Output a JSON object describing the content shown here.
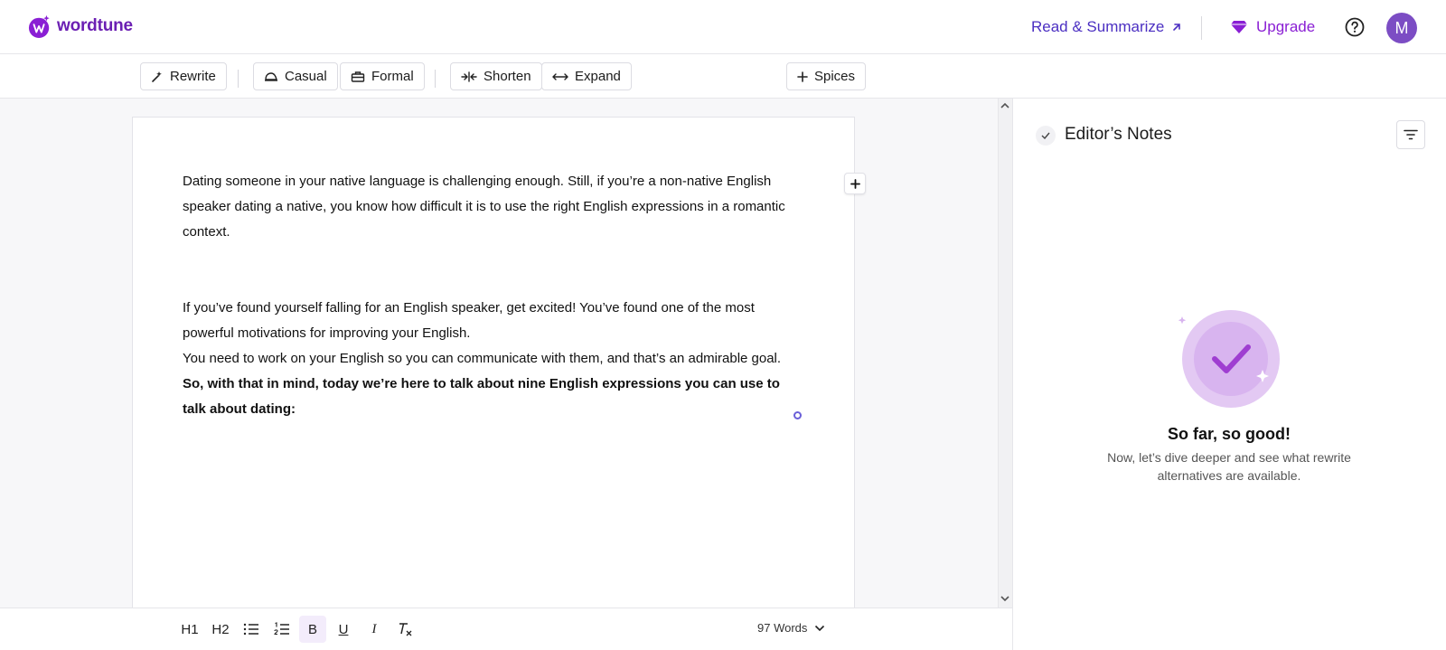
{
  "header": {
    "brand": "wordtune",
    "read_summarize": "Read & Summarize",
    "upgrade": "Upgrade",
    "avatar_initial": "M",
    "accent": "#8a1fd4"
  },
  "toolbar": {
    "rewrite": "Rewrite",
    "casual": "Casual",
    "formal": "Formal",
    "shorten": "Shorten",
    "expand": "Expand",
    "spices": "Spices"
  },
  "document": {
    "paragraphs": [
      "Dating someone in your native language is challenging enough. Still, if you’re a non-native English speaker dating a native, you know how difficult it is to use the right English expressions in a romantic context.",
      "If you’ve found yourself falling for an English speaker, get excited! You’ve found one of the most powerful motivations for improving your English.",
      "You need to work on your English so you can communicate with them, and that’s an admirable goal.",
      "So, with that in mind, today we’re here to talk about nine English expressions you can use to talk about dating:"
    ]
  },
  "format_bar": {
    "h1": "H1",
    "h2": "H2",
    "bold": "B",
    "underline": "U",
    "italic": "I",
    "word_count": "97 Words"
  },
  "notes_panel": {
    "title": "Editor’s Notes",
    "empty_title": "So far, so good!",
    "empty_subtitle": "Now, let’s dive deeper and see what rewrite alternatives are available."
  },
  "icons": [
    "logo-icon",
    "external-link-icon",
    "diamond-icon",
    "help-icon",
    "sparkle-icon",
    "casual-icon",
    "formal-icon",
    "shorten-icon",
    "expand-icon",
    "plus-icon",
    "bullet-list-icon",
    "numbered-list-icon",
    "clear-format-icon",
    "chevron-down-icon",
    "check-icon",
    "filter-icon"
  ]
}
